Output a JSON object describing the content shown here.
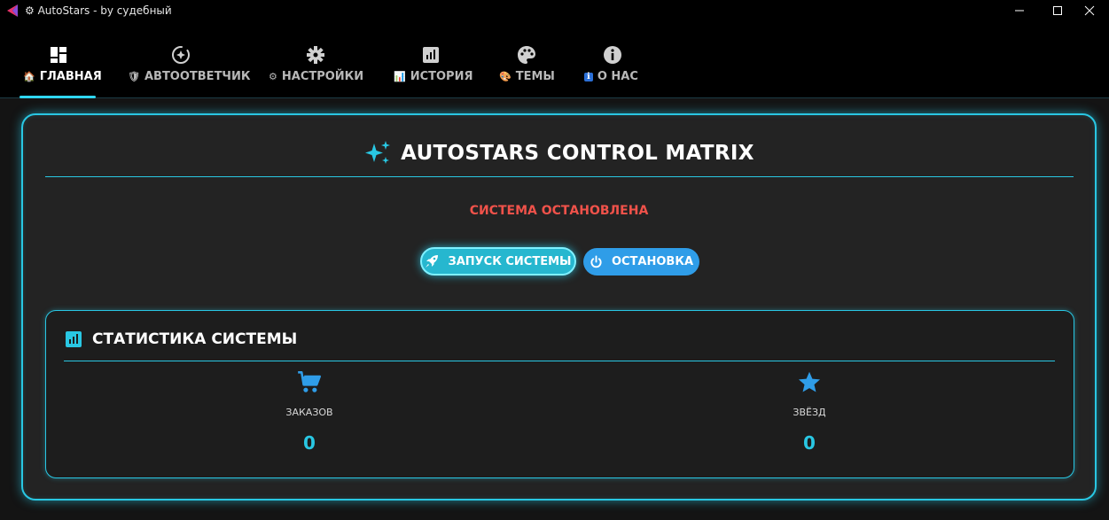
{
  "window": {
    "title": "AutoStars - by судебный",
    "title_prefix_icon": "gear-icon"
  },
  "tabs": [
    {
      "label": "ГЛАВНАЯ",
      "icon": "dashboard-icon",
      "emoji": "🏠",
      "active": true
    },
    {
      "label": "АВТООТВЕТЧИК",
      "icon": "autoresponder-icon",
      "emoji": "🛡",
      "active": false
    },
    {
      "label": "НАСТРОЙКИ",
      "icon": "gear-icon",
      "emoji": "⚙",
      "active": false
    },
    {
      "label": "ИСТОРИЯ",
      "icon": "chart-icon",
      "emoji": "📊",
      "active": false
    },
    {
      "label": "ТЕМЫ",
      "icon": "palette-icon",
      "emoji": "🎨",
      "active": false
    },
    {
      "label": "О НАС",
      "icon": "info-icon",
      "emoji": "ℹ",
      "active": false
    }
  ],
  "main": {
    "title": "AUTOSTARS CONTROL MATRIX",
    "status": "СИСТЕМА ОСТАНОВЛЕНА",
    "start_label": "ЗАПУСК СИСТЕМЫ",
    "stop_label": "ОСТАНОВКА"
  },
  "stats": {
    "title": "СТАТИСТИКА СИСТЕМЫ",
    "orders": {
      "label": "ЗАКАЗОВ",
      "value": "0",
      "icon": "cart-icon"
    },
    "stars": {
      "label": "ЗВЁЗД",
      "value": "0",
      "icon": "star-icon"
    }
  },
  "colors": {
    "accent": "#29c7e3",
    "status_stopped": "#f0524a",
    "stop_button": "#2f9de8",
    "value": "#29c7e3"
  }
}
